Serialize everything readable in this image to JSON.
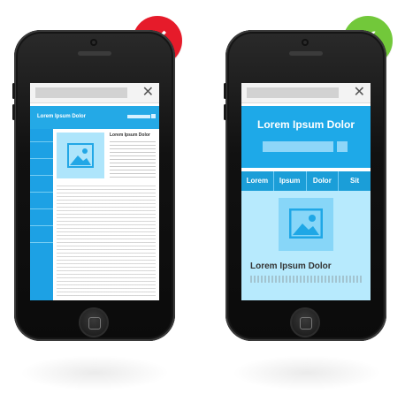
{
  "badges": {
    "bad_symbol": "✕",
    "good_symbol": "✓",
    "bad_color": "#e61b2a",
    "good_color": "#72c83a"
  },
  "left_phone": {
    "title": "Lorem Ipsum Dolor",
    "nav_items": [
      "",
      "",
      "",
      "",
      "",
      "",
      ""
    ],
    "article_title": "Lorem Ipsum Dolor"
  },
  "right_phone": {
    "title": "Lorem Ipsum Dolor",
    "tabs": [
      "Lorem",
      "Ipsum",
      "Dolor",
      "Sit"
    ],
    "card_title": "Lorem Ipsum Dolor"
  },
  "icons": {
    "close": "✕",
    "image": "image-icon"
  }
}
